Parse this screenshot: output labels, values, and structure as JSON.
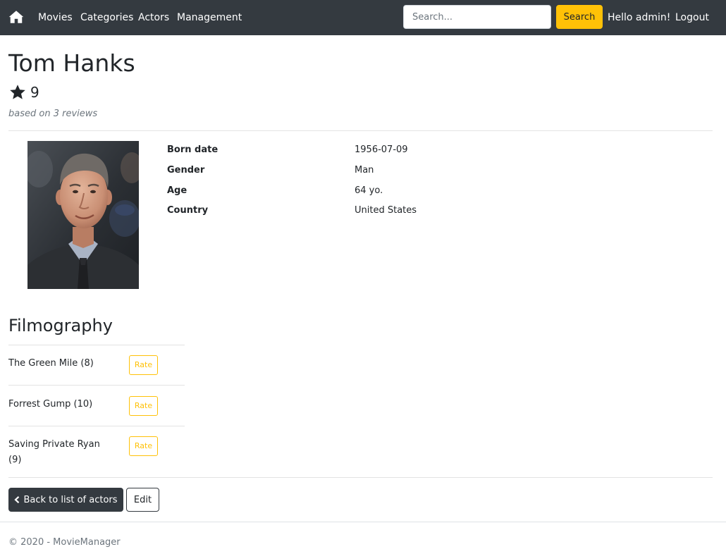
{
  "navbar": {
    "home_icon": "home-icon",
    "links": [
      {
        "label": "Movies"
      },
      {
        "label": "Categories"
      },
      {
        "label": "Actors"
      },
      {
        "label": "Management"
      }
    ],
    "search_placeholder": "Search...",
    "search_button": "Search",
    "greeting": "Hello admin!",
    "logout": "Logout",
    "colors": {
      "bar": "#343a40",
      "accent": "#ffc107"
    }
  },
  "actor": {
    "name": "Tom Hanks",
    "rating_icon": "star-icon",
    "rating": "9",
    "reviews": "based on 3 reviews",
    "details": [
      {
        "label": "Born date",
        "value": "1956-07-09"
      },
      {
        "label": "Gender",
        "value": "Man"
      },
      {
        "label": "Age",
        "value": "64 yo."
      },
      {
        "label": "Country",
        "value": "United States"
      }
    ]
  },
  "filmography": {
    "title": "Filmography",
    "rate_label": "Rate",
    "items": [
      {
        "title": "The Green Mile (8)"
      },
      {
        "title": "Forrest Gump (10)"
      },
      {
        "title": "Saving Private Ryan (9)"
      }
    ]
  },
  "actions": {
    "back_icon": "chevron-left-icon",
    "back": "Back to list of actors",
    "edit": "Edit"
  },
  "footer": {
    "text": "© 2020 - MovieManager"
  }
}
